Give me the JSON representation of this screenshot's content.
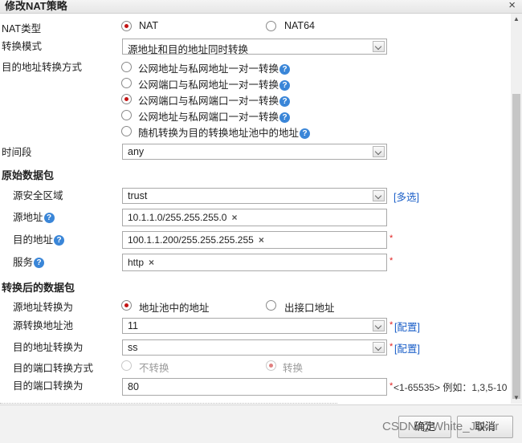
{
  "dialog": {
    "title": "修改NAT策略",
    "close_symbol": "×"
  },
  "nat_type": {
    "label": "NAT类型",
    "options": [
      "NAT",
      "NAT64"
    ],
    "selected": "NAT"
  },
  "mode": {
    "label": "转换模式",
    "value": "源地址和目的地址同时转换"
  },
  "dest_method": {
    "label": "目的地址转换方式",
    "options": [
      "公网地址与私网地址一对一转换",
      "公网端口与私网地址一对一转换",
      "公网端口与私网端口一对一转换",
      "公网地址与私网端口一对一转换",
      "随机转换为目的转换地址池中的地址"
    ],
    "selected_index": 2,
    "help": "?"
  },
  "time": {
    "label": "时间段",
    "value": "any"
  },
  "original": {
    "title": "原始数据包",
    "src_zone": {
      "label": "源安全区域",
      "value": "trust",
      "link": "[多选]"
    },
    "src_addr": {
      "label": "源地址",
      "tag": "10.1.1.0/255.255.255.0"
    },
    "dst_addr": {
      "label": "目的地址",
      "tag": "100.1.1.200/255.255.255.255"
    },
    "service": {
      "label": "服务",
      "tag": "http"
    },
    "remove_symbol": "×",
    "required": "*"
  },
  "translated": {
    "title": "转换后的数据包",
    "src_trans": {
      "label": "源地址转换为",
      "options": [
        "地址池中的地址",
        "出接口地址"
      ],
      "selected": "地址池中的地址"
    },
    "src_pool": {
      "label": "源转换地址池",
      "value": "11",
      "link": "[配置]"
    },
    "dst_trans": {
      "label": "目的地址转换为",
      "value": "ss",
      "link": "[配置]"
    },
    "port_method": {
      "label": "目的端口转换方式",
      "options": [
        "不转换",
        "转换"
      ],
      "selected": "转换"
    },
    "dst_port": {
      "label": "目的端口转换为",
      "value": "80",
      "hint": "<1-65535> 例如：1,3,5-10"
    }
  },
  "footer": {
    "ok": "确定",
    "cancel": "取消",
    "watermark": "CSDN @White_Joker"
  },
  "colors": {
    "accent_red": "#c41414",
    "link_blue": "#1b5fc8",
    "help_blue": "#3a86d8"
  }
}
